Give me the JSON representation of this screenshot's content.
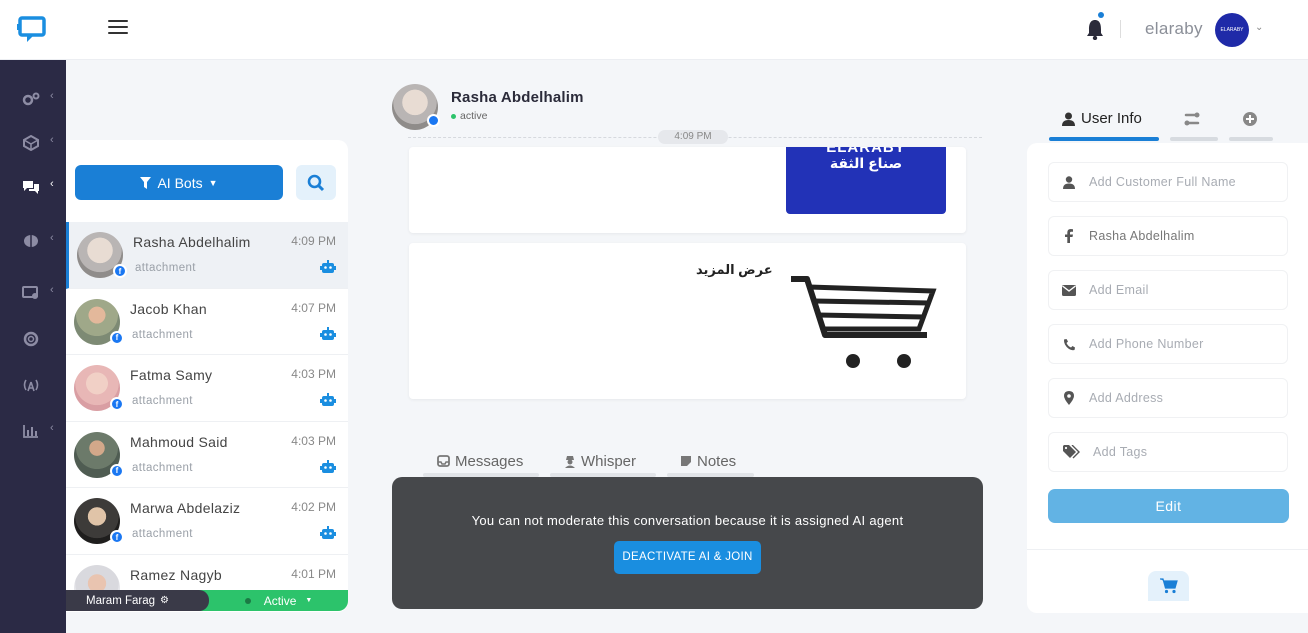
{
  "header": {
    "username": "elaraby",
    "avatar_text": "ELARABY"
  },
  "sidenav": {
    "items": [
      {
        "icon": "gears-icon"
      },
      {
        "icon": "cube-icon"
      },
      {
        "icon": "chats-icon",
        "active": true
      },
      {
        "icon": "brain-icon"
      },
      {
        "icon": "desktop-user-icon"
      },
      {
        "icon": "support-icon"
      },
      {
        "icon": "broadcast-icon"
      },
      {
        "icon": "analytics-icon"
      }
    ]
  },
  "conversations": {
    "filter_label": "AI Bots",
    "items": [
      {
        "name": "Rasha Abdelhalim",
        "time": "4:09 PM",
        "preview": "attachment"
      },
      {
        "name": "Jacob Khan",
        "time": "4:07 PM",
        "preview": "attachment"
      },
      {
        "name": "Fatma Samy",
        "time": "4:03 PM",
        "preview": "attachment"
      },
      {
        "name": "Mahmoud Said",
        "time": "4:03 PM",
        "preview": "attachment"
      },
      {
        "name": "Marwa Abdelaziz",
        "time": "4:02 PM",
        "preview": "attachment"
      },
      {
        "name": "Ramez Nagyb",
        "time": "4:01 PM",
        "preview": ""
      }
    ],
    "agent_name": "Maram Farag",
    "agent_status": "Active"
  },
  "chat": {
    "contact_name": "Rasha Abdelhalim",
    "contact_status": "active",
    "time_divider": "4:09 PM",
    "banner_line1": "ELARABY",
    "banner_line2": "صناع الثقة",
    "more_label": "عرض المزيد",
    "tabs": [
      "Messages",
      "Whisper",
      "Notes"
    ],
    "overlay_message": "You can not moderate this conversation because it is assigned AI agent",
    "deactivate_label": "DEACTIVATE AI & JOIN"
  },
  "user_info": {
    "tab_label": "User Info",
    "fields": [
      {
        "icon": "user-icon",
        "text": "Add Customer Full Name",
        "filled": false
      },
      {
        "icon": "facebook-icon",
        "text": "Rasha Abdelhalim",
        "filled": true
      },
      {
        "icon": "envelope-icon",
        "text": "Add Email",
        "filled": false
      },
      {
        "icon": "phone-icon",
        "text": "Add Phone Number",
        "filled": false
      },
      {
        "icon": "location-icon",
        "text": "Add Address",
        "filled": false
      },
      {
        "icon": "tags-icon",
        "text": "Add Tags",
        "filled": false
      }
    ],
    "edit_label": "Edit"
  },
  "colors": {
    "accent": "#1a7fd6",
    "sidebar": "#2b2a45",
    "active_green": "#2cc36b"
  }
}
